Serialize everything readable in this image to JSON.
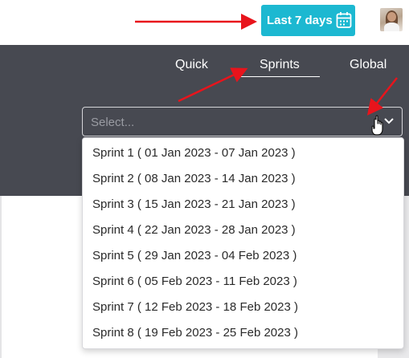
{
  "header": {
    "date_range_label": "Last 7 days",
    "date_range_icon": "calendar-icon",
    "avatar_icon": "user-avatar"
  },
  "tabs": [
    {
      "label": "Quick"
    },
    {
      "label": "Sprints",
      "active": true
    },
    {
      "label": "Global"
    }
  ],
  "sprint_select": {
    "placeholder": "Select...",
    "icon": "chevron-down-icon",
    "options": [
      "Sprint 1 ( 01 Jan 2023 - 07 Jan 2023 )",
      "Sprint 2 ( 08 Jan 2023 - 14 Jan 2023 )",
      "Sprint 3 ( 15 Jan 2023 - 21 Jan 2023 )",
      "Sprint 4 ( 22 Jan 2023 - 28 Jan 2023 )",
      "Sprint 5 ( 29 Jan 2023 - 04 Feb 2023 )",
      "Sprint 6 ( 05 Feb 2023 - 11 Feb 2023 )",
      "Sprint 7 ( 12 Feb 2023 - 18 Feb 2023 )",
      "Sprint 8 ( 19 Feb 2023 - 25 Feb 2023 )"
    ]
  },
  "colors": {
    "accent": "#1cb8d1",
    "panel": "#474951",
    "annotation_arrow": "#e8141c"
  }
}
